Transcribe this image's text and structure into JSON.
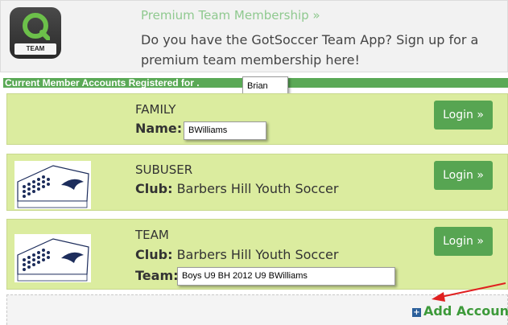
{
  "promo": {
    "link": "Premium Team Membership »",
    "text": "Do you have the GotSoccer Team App? Sign up for a premium team membership here!",
    "icon_label": "TEAM"
  },
  "header": {
    "label": "Current Member Accounts Registered for .",
    "name_value": "Brian"
  },
  "accounts": [
    {
      "type": "FAMILY",
      "field_label": "Name:",
      "field_value": "BWilliams",
      "login": "Login »"
    },
    {
      "type": "SUBUSER",
      "field_label": "Club:",
      "field_value": "Barbers Hill Youth Soccer",
      "login": "Login »",
      "logo_text": "BARBERS HILL YOUTH SOCCER"
    },
    {
      "type": "TEAM",
      "field_label": "Club:",
      "field_value": "Barbers Hill Youth Soccer",
      "team_label": "Team:",
      "team_value": "Boys U9 BH 2012 U9 BWilliams",
      "login": "Login »",
      "logo_text": "BARBERS HILL YOUTH SOCCER"
    }
  ],
  "add_account": "Add Account",
  "colors": {
    "green": "#57a552",
    "card": "#dbec9f",
    "link": "#8fc98f",
    "annotation": "#e02020"
  }
}
